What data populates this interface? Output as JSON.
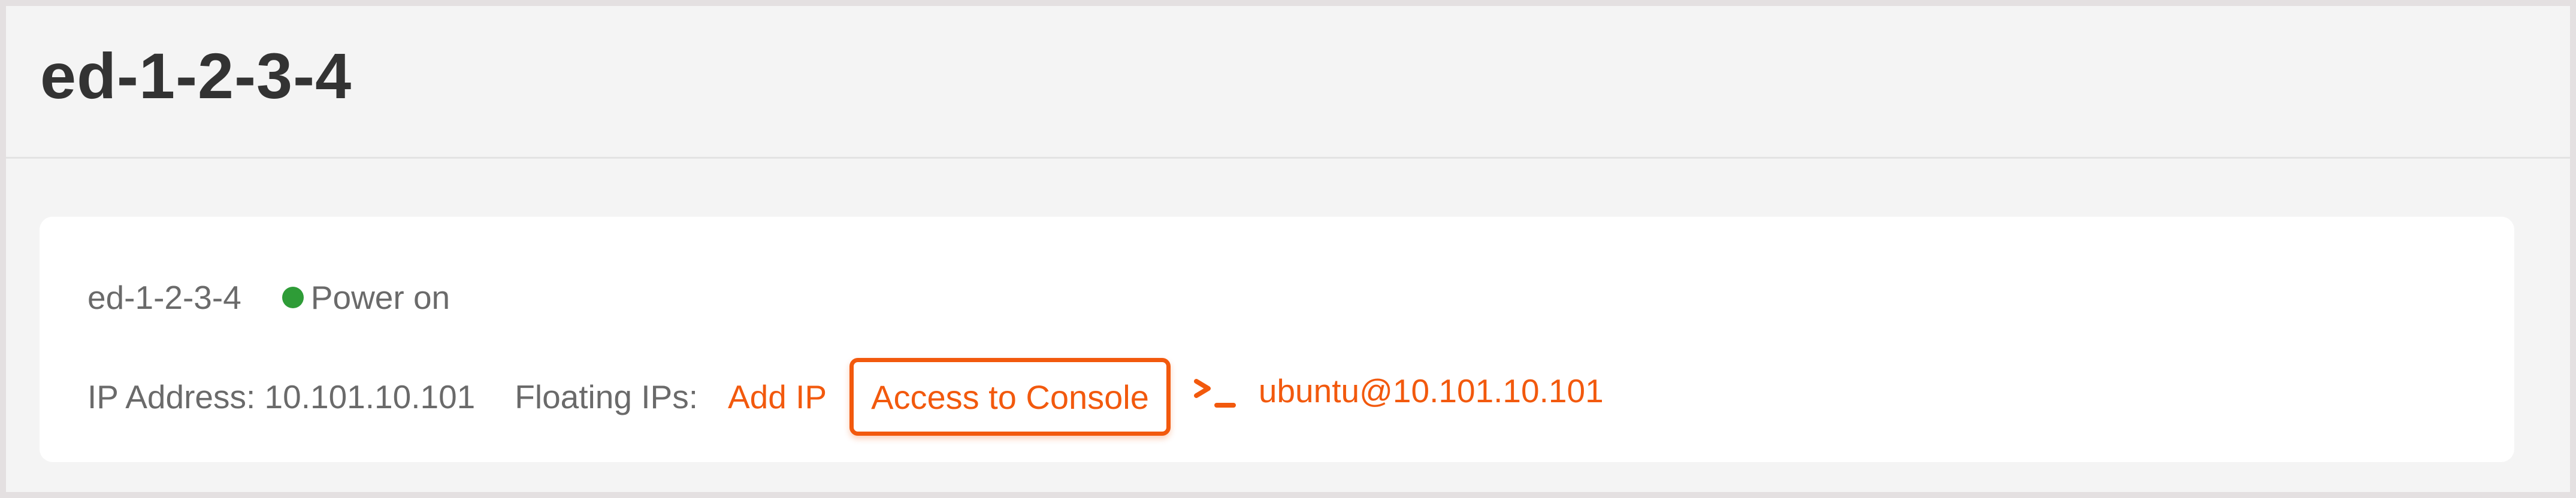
{
  "header": {
    "title": "ed-1-2-3-4"
  },
  "instance": {
    "name": "ed-1-2-3-4",
    "status": "Power on",
    "ip_address": "IP Address: 10.101.10.101",
    "floating_ips_label": "Floating IPs:",
    "add_ip_label": "Add IP",
    "console_button_label": "Access to Console",
    "ssh_command": "ubuntu@10.101.10.101"
  },
  "icons": {
    "status": "status-dot-icon",
    "terminal": "terminal-prompt-icon"
  },
  "colors": {
    "accent": "#f2590d",
    "status_on": "#2e9c37",
    "title_text": "#333333",
    "body_text": "#6a6a6a",
    "background": "#f4f4f4",
    "card": "#ffffff"
  }
}
